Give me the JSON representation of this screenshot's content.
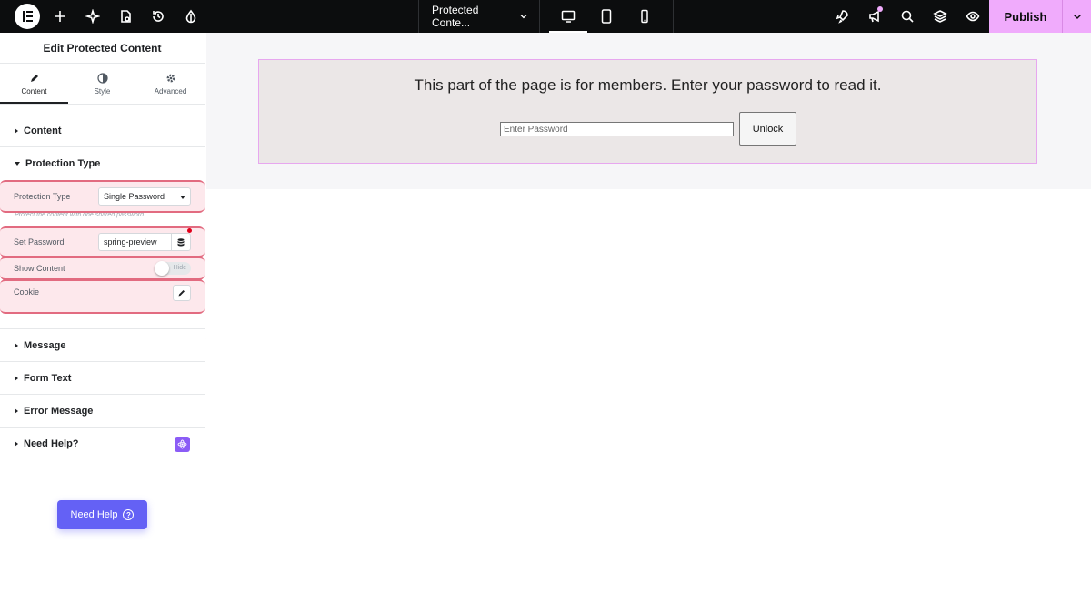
{
  "topbar": {
    "doc_title": "Protected Conte...",
    "publish_label": "Publish"
  },
  "panel": {
    "title": "Edit Protected Content",
    "tabs": [
      {
        "label": "Content",
        "icon": "pencil-icon",
        "active": true
      },
      {
        "label": "Style",
        "icon": "contrast-icon",
        "active": false
      },
      {
        "label": "Advanced",
        "icon": "gear-icon",
        "active": false
      }
    ],
    "sections": {
      "content": "Content",
      "protection_type": "Protection Type",
      "message": "Message",
      "form_text": "Form Text",
      "error_message": "Error Message",
      "need_help": "Need Help?"
    },
    "controls": {
      "protection_type_label": "Protection Type",
      "protection_type_value": "Single Password",
      "protection_type_desc": "Protect the content with one shared password.",
      "set_password_label": "Set Password",
      "set_password_value": "spring-preview",
      "show_content_label": "Show Content",
      "show_content_toggle": "Hide",
      "cookie_label": "Cookie"
    },
    "need_help_button": "Need Help",
    "help_symbol": "?"
  },
  "canvas": {
    "message": "This part of the page is for members. Enter your password to read it.",
    "password_placeholder": "Enter Password",
    "unlock_label": "Unlock"
  },
  "colors": {
    "accent": "#f0abfc",
    "highlight": "#e26b80",
    "help_button": "#6461f5"
  }
}
